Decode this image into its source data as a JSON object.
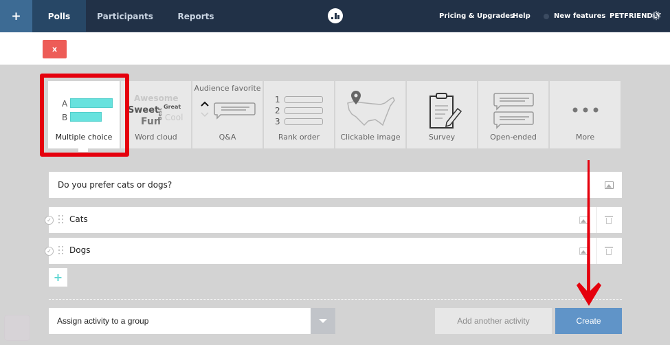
{
  "topbar": {
    "add_label": "+",
    "tabs": [
      {
        "label": "Polls",
        "active": true
      },
      {
        "label": "Participants",
        "active": false
      },
      {
        "label": "Reports",
        "active": false
      }
    ],
    "logo_icon": "poll-everywhere-logo",
    "right_links": {
      "pricing": "Pricing & Upgrades",
      "help": "Help",
      "new_features": "New features",
      "account": "PETFRIENDLY"
    },
    "settings_icon": "gear-icon"
  },
  "close_label": "x",
  "activity_types": [
    {
      "label": "Multiple choice",
      "icon": "multiple-choice-icon",
      "selected": true,
      "choices": [
        "A",
        "B"
      ]
    },
    {
      "label": "Word cloud",
      "icon": "word-cloud-icon",
      "selected": false,
      "words": [
        "Awesome",
        "Sweet",
        "Best",
        "Great",
        "Fun",
        "Cool"
      ]
    },
    {
      "label": "Q&A",
      "icon": "qa-icon",
      "selected": false,
      "caption": "Audience favorite"
    },
    {
      "label": "Rank order",
      "icon": "rank-order-icon",
      "selected": false,
      "ranks": [
        "1",
        "2",
        "3"
      ]
    },
    {
      "label": "Clickable image",
      "icon": "map-pin-icon",
      "selected": false
    },
    {
      "label": "Survey",
      "icon": "clipboard-icon",
      "selected": false
    },
    {
      "label": "Open-ended",
      "icon": "speech-bubbles-icon",
      "selected": false
    },
    {
      "label": "More",
      "icon": "ellipsis-icon",
      "selected": false
    }
  ],
  "question": {
    "value": "Do you prefer cats or dogs?",
    "image_icon": "image-icon"
  },
  "options": [
    {
      "label": "Cats"
    },
    {
      "label": "Dogs"
    }
  ],
  "add_option_label": "+",
  "footer": {
    "group_select": "Assign activity to a group",
    "add_another": "Add another activity",
    "create": "Create"
  },
  "colors": {
    "nav_bg": "#213147",
    "active_tab": "#274766",
    "create_button": "#6094c8",
    "close_button": "#ed5c57",
    "accent_teal": "#67e2de",
    "annotation_red": "#e5000d"
  }
}
